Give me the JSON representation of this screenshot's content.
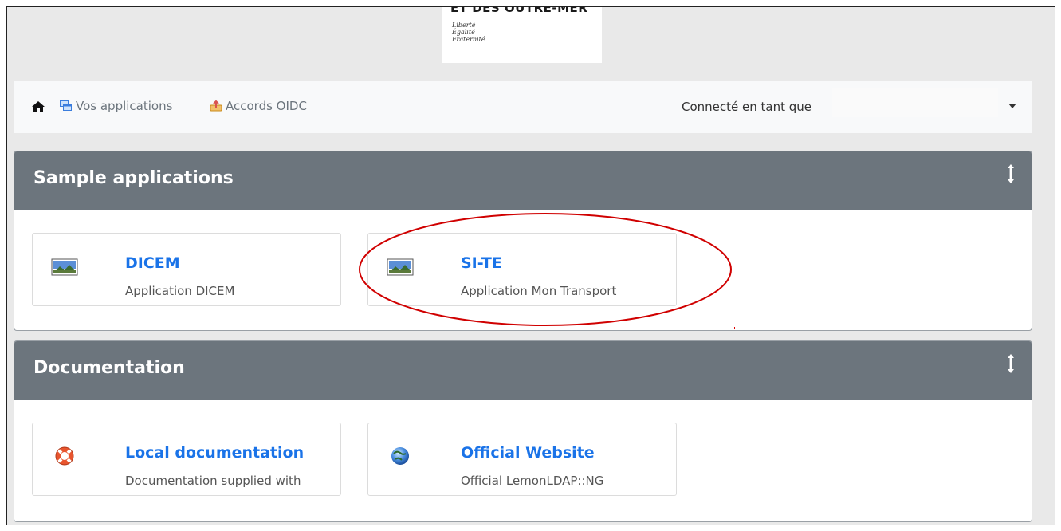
{
  "header": {
    "logo_title": "ET DES OUTRE-MER",
    "motto": [
      "Liberté",
      "Égalité",
      "Fraternité"
    ]
  },
  "nav": {
    "apps_label": "Vos applications",
    "oidc_label": "Accords OIDC",
    "connected_label": "Connecté en tant que",
    "username": ""
  },
  "sections": [
    {
      "title": "Sample applications",
      "apps": [
        {
          "name": "DICEM",
          "description": "Application DICEM",
          "icon": "application-image-icon"
        },
        {
          "name": "SI-TE",
          "description": "Application Mon Transport",
          "icon": "application-image-icon"
        }
      ]
    },
    {
      "title": "Documentation",
      "apps": [
        {
          "name": "Local documentation",
          "description": "Documentation supplied with",
          "icon": "lifebuoy-icon"
        },
        {
          "name": "Official Website",
          "description": "Official LemonLDAP::NG",
          "icon": "globe-icon"
        }
      ]
    }
  ],
  "colors": {
    "panel_header": "#6c757d",
    "link": "#1a73e8",
    "annotation": "#d00000"
  }
}
